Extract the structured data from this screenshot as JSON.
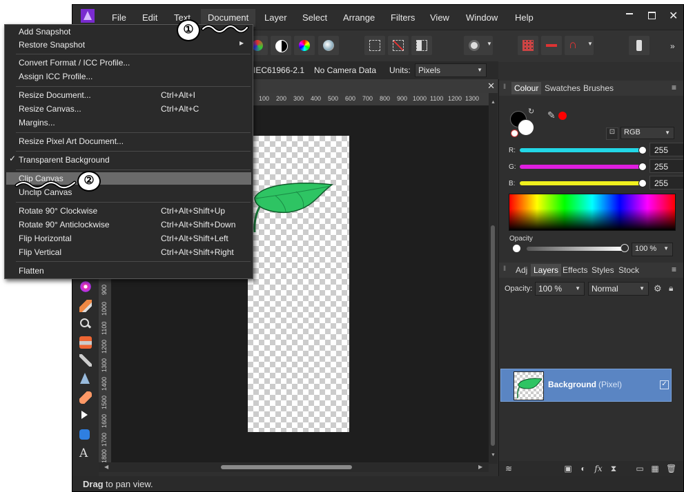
{
  "menubar": {
    "items": [
      "File",
      "Edit",
      "Text",
      "Document",
      "Layer",
      "Select",
      "Arrange",
      "Filters",
      "View",
      "Window",
      "Help"
    ]
  },
  "context_bar": {
    "profile": "IEC61966-2.1",
    "camera": "No Camera Data",
    "units_label": "Units:",
    "units_value": "Pixels"
  },
  "ruler": {
    "top_ticks": [
      "100",
      "200",
      "300",
      "400",
      "500",
      "600",
      "700",
      "800",
      "900",
      "1000",
      "1100",
      "1200",
      "1300"
    ],
    "left_ticks": [
      "900",
      "1000",
      "1100",
      "1200",
      "1300",
      "1400",
      "1500",
      "1600",
      "1700",
      "1800"
    ]
  },
  "document_menu": {
    "items": [
      {
        "label": "Add Snapshot",
        "shortcut": ""
      },
      {
        "label": "Restore Snapshot",
        "shortcut": ""
      },
      {
        "label": "Convert Format / ICC Profile...",
        "shortcut": ""
      },
      {
        "label": "Assign ICC Profile...",
        "shortcut": ""
      },
      {
        "label": "Resize Document...",
        "shortcut": "Ctrl+Alt+I"
      },
      {
        "label": "Resize Canvas...",
        "shortcut": "Ctrl+Alt+C"
      },
      {
        "label": "Margins...",
        "shortcut": ""
      },
      {
        "label": "Resize Pixel Art Document...",
        "shortcut": ""
      },
      {
        "label": "Transparent Background",
        "shortcut": ""
      },
      {
        "label": "Clip Canvas",
        "shortcut": ""
      },
      {
        "label": "Unclip Canvas",
        "shortcut": ""
      },
      {
        "label": "Rotate 90° Clockwise",
        "shortcut": "Ctrl+Alt+Shift+Up"
      },
      {
        "label": "Rotate 90° Anticlockwise",
        "shortcut": "Ctrl+Alt+Shift+Down"
      },
      {
        "label": "Flip Horizontal",
        "shortcut": "Ctrl+Alt+Shift+Left"
      },
      {
        "label": "Flip Vertical",
        "shortcut": "Ctrl+Alt+Shift+Right"
      },
      {
        "label": "Flatten",
        "shortcut": ""
      }
    ],
    "checked_item": "Transparent Background",
    "highlighted_item": "Clip Canvas"
  },
  "annotations": {
    "step1": "①",
    "step2": "②"
  },
  "colour_panel": {
    "tabs": [
      "Colour",
      "Swatches",
      "Brushes"
    ],
    "active_tab": "Colour",
    "model": "RGB",
    "r_label": "R:",
    "g_label": "G:",
    "b_label": "B:",
    "r_value": "255",
    "g_value": "255",
    "b_value": "255",
    "opacity_label": "Opacity",
    "opacity_value": "100 %",
    "colors": {
      "r_slider": "#23d7e6",
      "g_slider": "#e01ee0",
      "b_slider": "#f0f01e",
      "fill_swatch": "#000000",
      "stroke_swatch": "#ffffff",
      "picker": "#ff0000"
    }
  },
  "layers_panel": {
    "tabs": [
      "Adj",
      "Layers",
      "Effects",
      "Styles",
      "Stock"
    ],
    "active_tab": "Layers",
    "opacity_label": "Opacity:",
    "opacity_value": "100 %",
    "blend_mode": "Normal",
    "layer_name": "Background",
    "layer_type": "(Pixel)"
  },
  "status": {
    "bold": "Drag",
    "text": " to pan view."
  },
  "colors": {
    "accent_layer": "#5a85c3",
    "leaf": "#2ec463"
  }
}
